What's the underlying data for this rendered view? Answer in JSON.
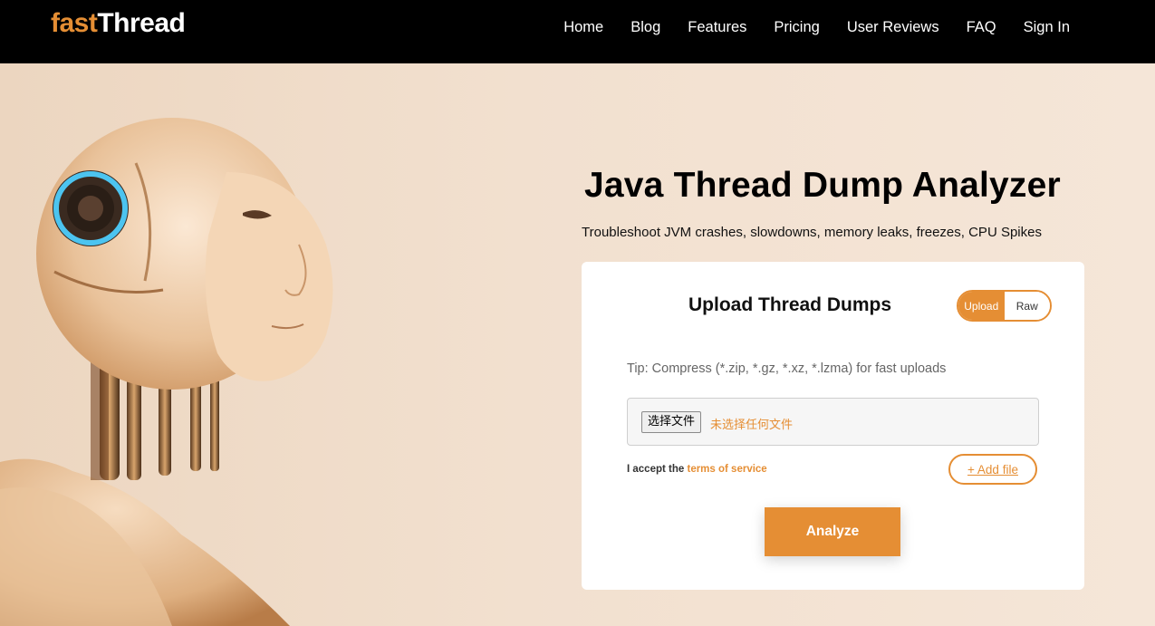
{
  "brand": {
    "logo_part1": "fast",
    "logo_part2": "Thread"
  },
  "nav": {
    "items": [
      "Home",
      "Blog",
      "Features",
      "Pricing",
      "User Reviews",
      "FAQ",
      "Sign In"
    ]
  },
  "hero": {
    "title": "Java Thread Dump Analyzer",
    "subtitle": "Troubleshoot JVM crashes, slowdowns, memory leaks, freezes, CPU Spikes"
  },
  "upload_card": {
    "title": "Upload Thread Dumps",
    "toggle": {
      "options": [
        "Upload",
        "Raw"
      ],
      "selected": "Upload"
    },
    "tip": "Tip: Compress (*.zip, *.gz, *.xz, *.lzma) for fast uploads",
    "file_input": {
      "button_label": "选择文件",
      "status": "未选择任何文件"
    },
    "accept_prefix": "I accept the",
    "accept_link": "terms of service",
    "add_file_label": "+ Add file",
    "analyze_label": "Analyze"
  },
  "colors": {
    "accent": "#e58e34",
    "navbar": "#000000",
    "background": "#f3e2d2"
  },
  "icons": {
    "robot_image": "robot-illustration"
  }
}
